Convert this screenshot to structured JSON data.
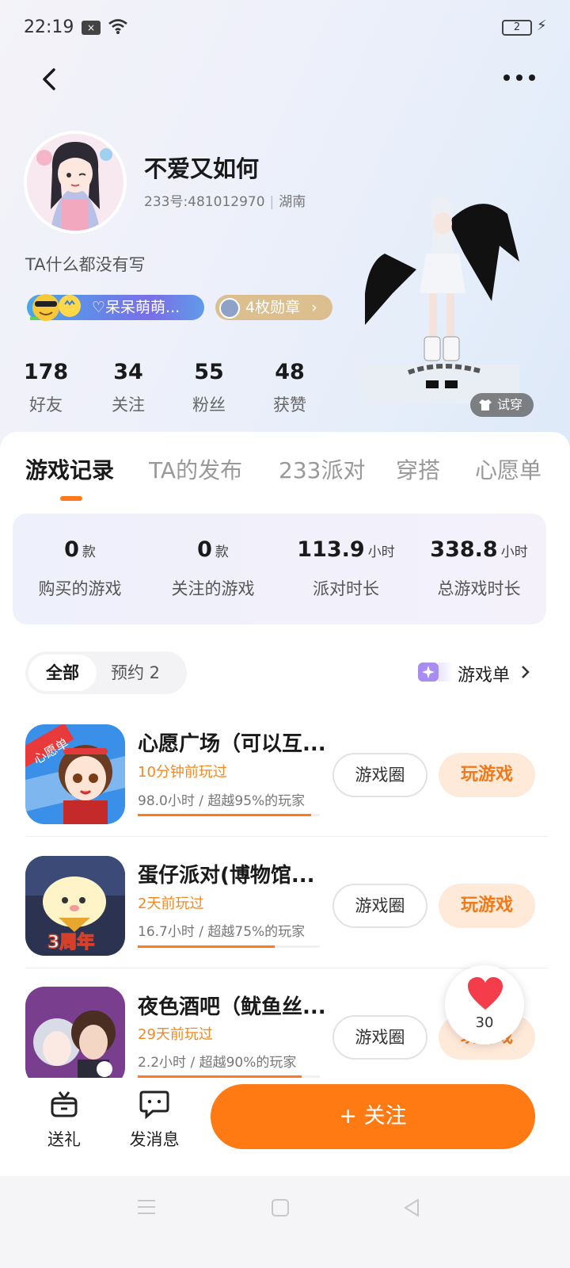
{
  "status_bar": {
    "time": "22:19",
    "x_badge": "×",
    "battery": "2"
  },
  "profile": {
    "nickname": "不爱又如何",
    "uid_text": "233号:481012970",
    "location": "湖南",
    "bio": "TA什么都没有写",
    "club_label": "♡呆呆萌萌...",
    "medal_label": "4枚勋章",
    "stats": [
      {
        "value": "178",
        "label": "好友"
      },
      {
        "value": "34",
        "label": "关注"
      },
      {
        "value": "55",
        "label": "粉丝"
      },
      {
        "value": "48",
        "label": "获赞"
      }
    ],
    "try_on_label": "试穿"
  },
  "tabs": [
    {
      "label": "游戏记录",
      "active": true
    },
    {
      "label": "TA的发布",
      "active": false
    },
    {
      "label": "233派对",
      "active": false
    },
    {
      "label": "穿搭",
      "active": false
    },
    {
      "label": "心愿单",
      "active": false
    }
  ],
  "summary": [
    {
      "value": "0",
      "unit": "款",
      "label": "购买的游戏"
    },
    {
      "value": "0",
      "unit": "款",
      "label": "关注的游戏"
    },
    {
      "value": "113.9",
      "unit": "小时",
      "label": "派对时长"
    },
    {
      "value": "338.8",
      "unit": "小时",
      "label": "总游戏时长"
    }
  ],
  "filter": {
    "all_label": "全部",
    "reserve_label": "预约 2",
    "gamelist_label": "游戏单"
  },
  "games": [
    {
      "title": "心愿广场（可以互...",
      "last_played": "10分钟前玩过",
      "meta": "98.0小时 / 超越95%的玩家",
      "progress": 0.95,
      "circle_label": "游戏圈",
      "play_label": "玩游戏"
    },
    {
      "title": "蛋仔派对(博物馆...",
      "last_played": "2天前玩过",
      "meta": "16.7小时 / 超越75%的玩家",
      "progress": 0.75,
      "circle_label": "游戏圈",
      "play_label": "玩游戏"
    },
    {
      "title": "夜色酒吧（鱿鱼丝...",
      "last_played": "29天前玩过",
      "meta": "2.2小时 / 超越90%的玩家",
      "progress": 0.9,
      "circle_label": "游戏圈",
      "play_label": "玩游戏"
    }
  ],
  "game_icon_texts": {
    "wish_tag": "心愿单",
    "anniv_tag": "3周年"
  },
  "like": {
    "count": "30"
  },
  "actions": {
    "gift_label": "送礼",
    "message_label": "发消息",
    "follow_label": "+ 关注"
  },
  "colors": {
    "accent": "#ff7a12",
    "accent_soft": "#ffe9d9",
    "recent_text": "#f08a24"
  }
}
